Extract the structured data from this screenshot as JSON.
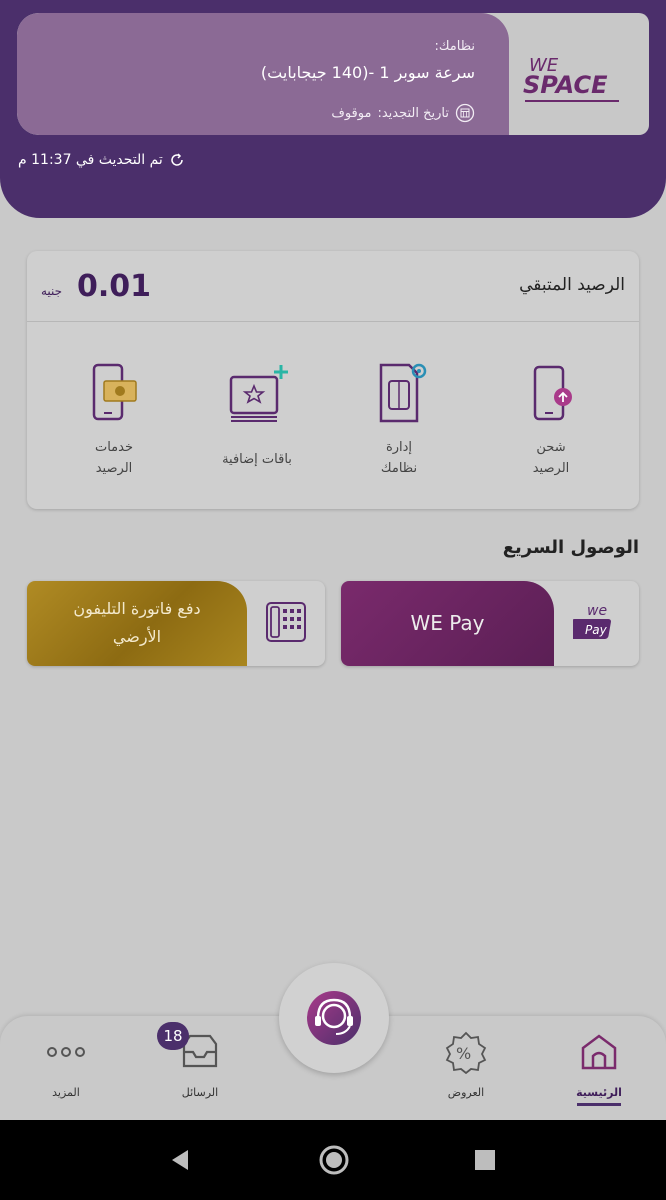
{
  "header": {
    "plan_label": "نظامك:",
    "plan_name": "سرعة سوبر 1 -(140 جيجابايت)",
    "renewal_label": "تاريخ التجديد:",
    "renewal_value": "موقوف",
    "last_updated": "تم التحديث في 11:37 م",
    "logo_top": "WE",
    "logo_bottom": "SPACE"
  },
  "balance": {
    "title": "الرصيد المتبقي",
    "value": "0.01",
    "currency": "جنيه"
  },
  "services": [
    {
      "label_line1": "شحن",
      "label_line2": "الرصيد",
      "icon": "phone-recharge-icon"
    },
    {
      "label_line1": "إدارة",
      "label_line2": "نظامك",
      "icon": "sim-settings-icon"
    },
    {
      "label_line1": "باقات إضافية",
      "label_line2": "",
      "icon": "add-bundle-icon"
    },
    {
      "label_line1": "خدمات",
      "label_line2": "الرصيد",
      "icon": "balance-services-icon"
    }
  ],
  "quick_access": {
    "title": "الوصول السريع",
    "we_pay_label": "WE Pay",
    "landline_line1": "دفع فاتورة التليفون",
    "landline_line2": "الأرضي"
  },
  "bottom_nav": {
    "home": "الرئيسية",
    "offers": "العروض",
    "messages": "الرسائل",
    "more": "المزيد",
    "messages_badge": "18"
  },
  "colors": {
    "brand_purple": "#4b2f6b",
    "gold": "#a9861f",
    "magenta": "#7a2a6c"
  }
}
